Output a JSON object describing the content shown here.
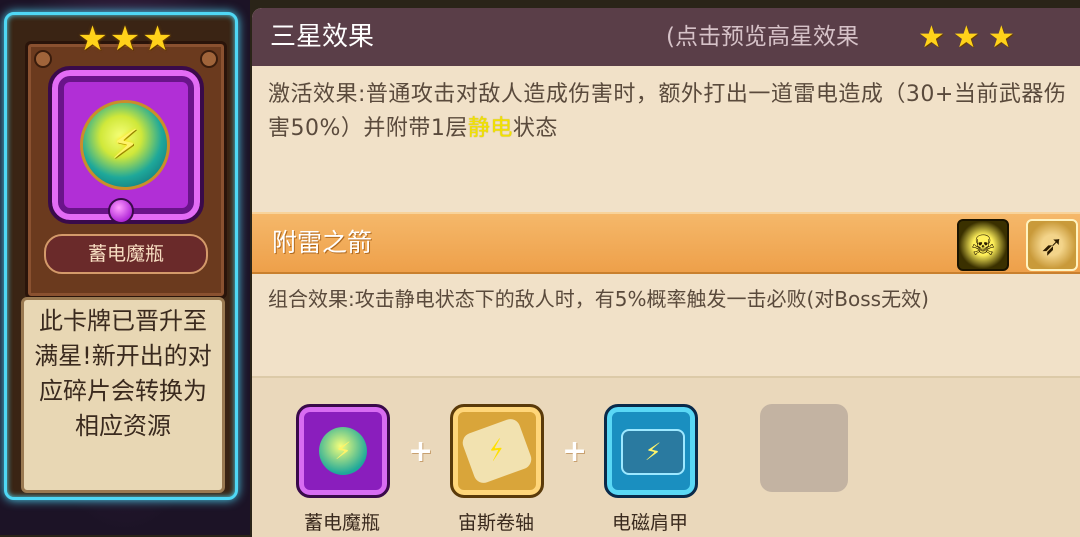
{
  "card": {
    "star_count": 3,
    "name": "蓄电魔瓶",
    "notice": "此卡牌已晋升至满星!新开出的对应碎片会转换为相应资源"
  },
  "panel": {
    "title": "三星效果",
    "hint": "(点击预览高星效果",
    "preview_star_count": 3,
    "effect_prefix": "激活效果:普通攻击对敌人造成伤害时，额外打出一道雷电造成（30+当前武器伤害50%）并附带1层",
    "effect_highlight": "静电",
    "effect_suffix": "状态",
    "highlight_color": "#f2e200"
  },
  "combo": {
    "title": "附雷之箭",
    "icons": [
      "skull-lightning-icon",
      "arrow-icon"
    ],
    "text": "组合效果:攻击静电状态下的敌人时，有5%概率触发一击必败(对Boss无效)"
  },
  "items": [
    {
      "name": "蓄电魔瓶",
      "icon": "lightning-bottle-icon"
    },
    {
      "name": "宙斯卷轴",
      "icon": "scroll-icon"
    },
    {
      "name": "电磁肩甲",
      "icon": "shoulder-armor-icon"
    }
  ],
  "plus_sign": "+"
}
